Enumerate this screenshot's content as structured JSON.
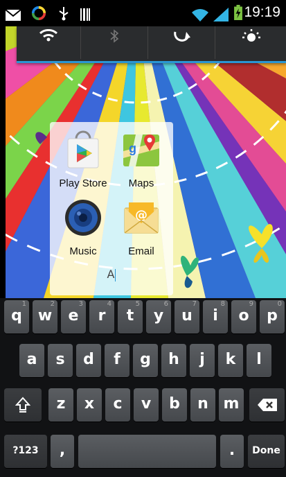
{
  "status_bar": {
    "time": "19:19",
    "icons": [
      "mail-icon",
      "sync-icon",
      "usb-icon",
      "barcode-icon",
      "wifi-icon",
      "signal-icon",
      "battery-charging-icon"
    ]
  },
  "quick_settings": {
    "tiles": [
      "wifi-icon",
      "bluetooth-icon",
      "auto-rotate-icon",
      "brightness-icon"
    ]
  },
  "folder": {
    "name_value": "A",
    "apps": [
      {
        "label": "Play Store",
        "icon": "play-store-icon"
      },
      {
        "label": "Maps",
        "icon": "maps-icon"
      },
      {
        "label": "Music",
        "icon": "music-icon"
      },
      {
        "label": "Email",
        "icon": "email-icon"
      }
    ]
  },
  "keyboard": {
    "row1": [
      {
        "label": "q",
        "hint": "1"
      },
      {
        "label": "w",
        "hint": "2"
      },
      {
        "label": "e",
        "hint": "3"
      },
      {
        "label": "r",
        "hint": "4"
      },
      {
        "label": "t",
        "hint": "5"
      },
      {
        "label": "y",
        "hint": "6"
      },
      {
        "label": "u",
        "hint": "7"
      },
      {
        "label": "i",
        "hint": "8"
      },
      {
        "label": "o",
        "hint": "9"
      },
      {
        "label": "p",
        "hint": "0"
      }
    ],
    "row2": [
      "a",
      "s",
      "d",
      "f",
      "g",
      "h",
      "j",
      "k",
      "l"
    ],
    "row3": [
      "z",
      "x",
      "c",
      "v",
      "b",
      "n",
      "m"
    ],
    "symbols_label": "?123",
    "comma_label": ",",
    "period_label": ".",
    "done_label": "Done"
  },
  "colors": {
    "accent": "#2a96d3",
    "key_top": "#5b5e62",
    "key_bottom": "#45484c"
  }
}
